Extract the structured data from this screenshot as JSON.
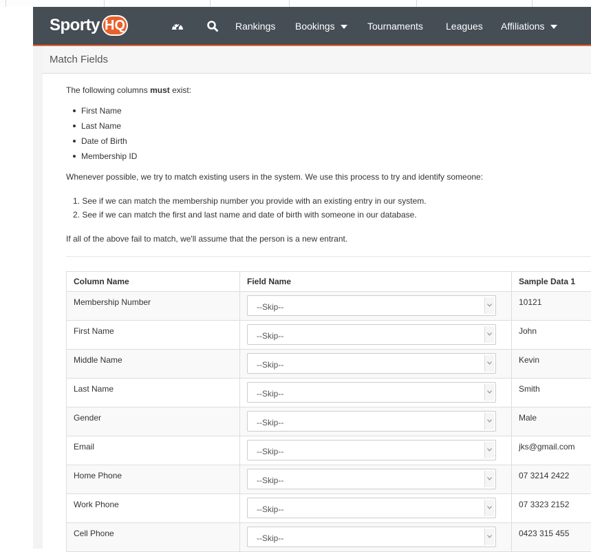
{
  "brand": {
    "logo_word": "Sporty",
    "logo_badge": "HQ",
    "accent_color": "#e8612c",
    "navbar_color": "#454d55"
  },
  "nav": {
    "dashboard_icon": "dashboard-icon",
    "search_icon": "search-icon",
    "links": [
      "Rankings",
      "Bookings",
      "Tournaments",
      "Leagues",
      "Affiliations"
    ]
  },
  "panel": {
    "title": "Match Fields"
  },
  "intro": {
    "before_bold": "The following columns ",
    "bold": "must",
    "after_bold": " exist:"
  },
  "required_columns": [
    "First Name",
    "Last Name",
    "Date of Birth",
    "Membership ID"
  ],
  "matching_text": "Whenever possible, we try to match existing users in the system. We use this process to try and identify someone:",
  "matching_steps": [
    "1. See if we can match the membership number you provide with an existing entry in our system.",
    "2. See if we can match the first and last name and date of birth with someone in our database."
  ],
  "fallback_text": "If all of the above fail to match, we'll assume that the person is a new entrant.",
  "table": {
    "headers": [
      "Column Name",
      "Field Name",
      "Sample Data 1"
    ],
    "rows": [
      {
        "column": "Membership Number",
        "field": "--Skip--",
        "sample": "10121"
      },
      {
        "column": "First Name",
        "field": "--Skip--",
        "sample": "John"
      },
      {
        "column": "Middle Name",
        "field": "--Skip--",
        "sample": "Kevin"
      },
      {
        "column": "Last Name",
        "field": "--Skip--",
        "sample": "Smith"
      },
      {
        "column": "Gender",
        "field": "--Skip--",
        "sample": "Male"
      },
      {
        "column": "Email",
        "field": "--Skip--",
        "sample": "jks@gmail.com"
      },
      {
        "column": "Home Phone",
        "field": "--Skip--",
        "sample": "07 3214 2422"
      },
      {
        "column": "Work Phone",
        "field": "--Skip--",
        "sample": "07 3323 2152"
      },
      {
        "column": "Cell Phone",
        "field": "--Skip--",
        "sample": "0423 315 455"
      }
    ]
  }
}
